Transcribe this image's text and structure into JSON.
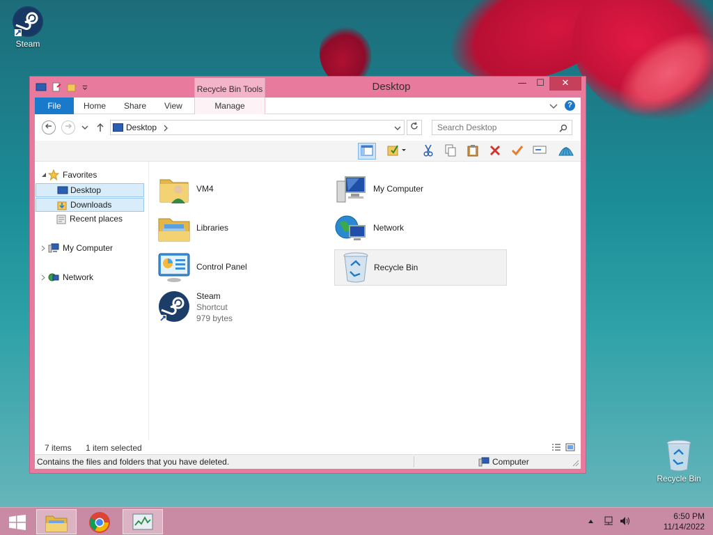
{
  "desktop": {
    "icons": [
      {
        "label": "Steam",
        "icon": "steam-icon"
      },
      {
        "label": "Recycle Bin",
        "icon": "recycle-bin-icon"
      }
    ]
  },
  "window": {
    "title": "Desktop",
    "context_tab": "Recycle Bin Tools",
    "controls": {
      "minimize": "—",
      "maximize": "☐",
      "close": "✕"
    }
  },
  "ribbon": {
    "tabs": [
      {
        "label": "File"
      },
      {
        "label": "Home"
      },
      {
        "label": "Share"
      },
      {
        "label": "View"
      },
      {
        "label": "Manage"
      }
    ],
    "help": "?"
  },
  "address": {
    "path": "Desktop",
    "search_placeholder": "Search Desktop"
  },
  "toolbar": {
    "buttons": [
      "layout-pane-icon",
      "properties-icon",
      "cut-icon",
      "copy-icon",
      "paste-icon",
      "delete-icon",
      "check-icon",
      "rename-icon",
      "shell-icon"
    ]
  },
  "navpane": {
    "items": [
      {
        "label": "Favorites",
        "icon": "star-icon"
      },
      {
        "label": "Desktop",
        "icon": "desktop-icon"
      },
      {
        "label": "Downloads",
        "icon": "downloads-icon"
      },
      {
        "label": "Recent places",
        "icon": "recent-places-icon"
      },
      {
        "label": "My Computer",
        "icon": "computer-icon"
      },
      {
        "label": "Network",
        "icon": "network-icon"
      }
    ]
  },
  "content": {
    "items": [
      {
        "name": "VM4",
        "icon": "user-folder-icon"
      },
      {
        "name": "My Computer",
        "icon": "computer-icon"
      },
      {
        "name": "Libraries",
        "icon": "libraries-icon"
      },
      {
        "name": "Network",
        "icon": "network-icon"
      },
      {
        "name": "Control Panel",
        "icon": "control-panel-icon"
      },
      {
        "name": "Recycle Bin",
        "icon": "recycle-bin-icon"
      },
      {
        "name": "Steam",
        "type": "Shortcut",
        "size": "979 bytes",
        "icon": "steam-icon"
      }
    ]
  },
  "status": {
    "item_count": "7 items",
    "selection": "1 item selected",
    "description": "Contains the files and folders that you have deleted.",
    "zone": "Computer"
  },
  "taskbar": {
    "time": "6:50 PM",
    "date": "11/14/2022",
    "apps": [
      "file-explorer-icon",
      "chrome-icon",
      "task-manager-icon"
    ]
  },
  "colors": {
    "accent": "#e87a9e",
    "file_tab": "#1979ca",
    "taskbar": "#c98aa3",
    "close": "#c7405b"
  }
}
